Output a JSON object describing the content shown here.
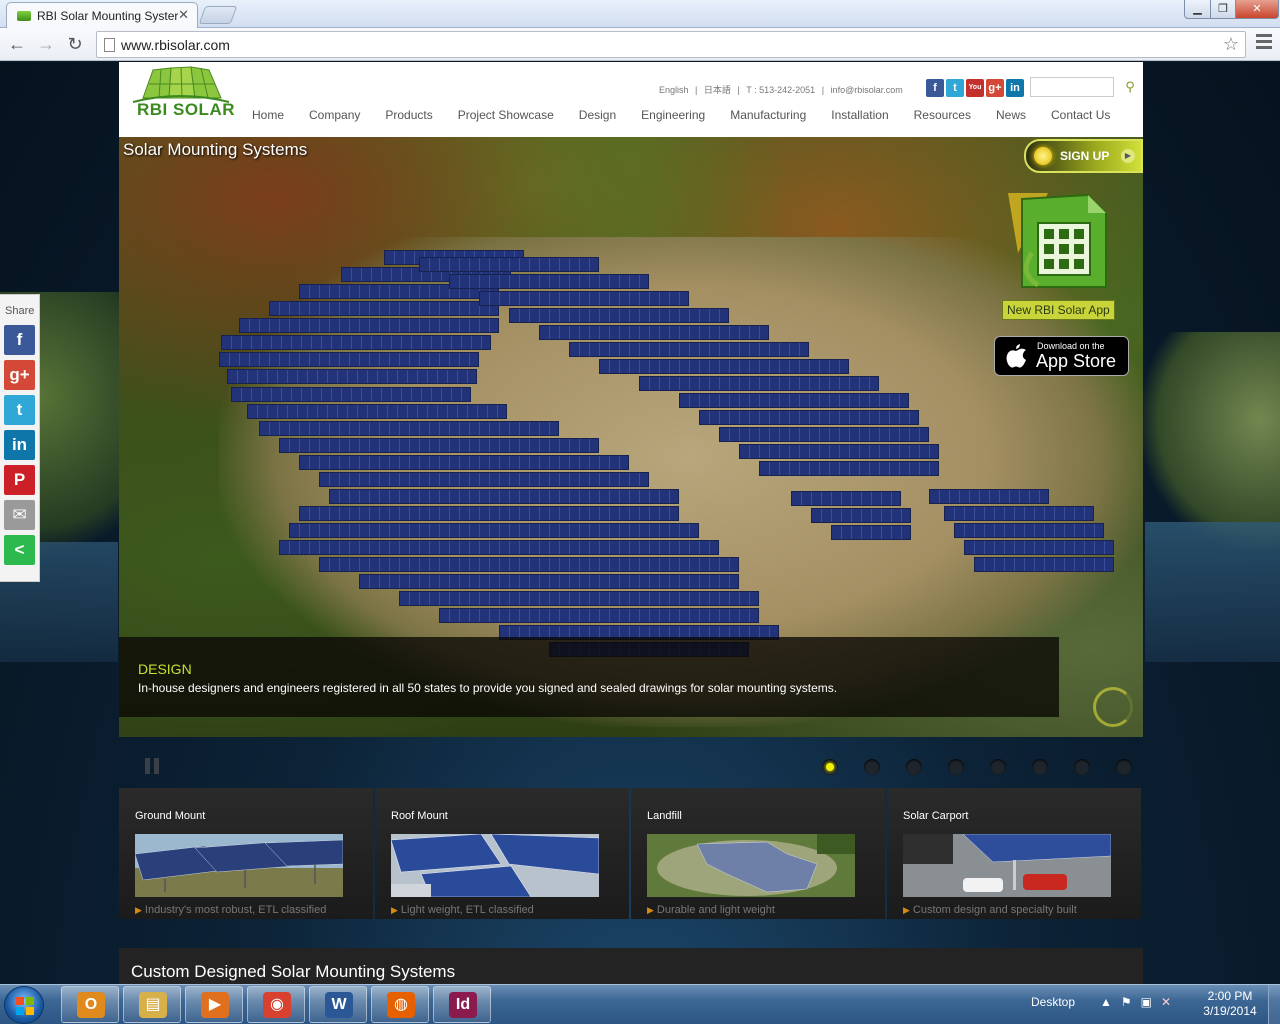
{
  "browser": {
    "tab_title": "RBI Solar Mounting Syster",
    "url": "www.rbisolar.com"
  },
  "header": {
    "logo_text": "RBI SOLAR",
    "top_links": [
      "English",
      "|",
      "日本語",
      "|",
      "T : 513-242-2051",
      "|",
      "info@rbisolar.com"
    ],
    "social": [
      {
        "name": "facebook-icon",
        "glyph": "f",
        "color": "#3b5998"
      },
      {
        "name": "twitter-icon",
        "glyph": "t",
        "color": "#2fa8d8"
      },
      {
        "name": "youtube-icon",
        "glyph": "You",
        "color": "#c4302b"
      },
      {
        "name": "google-plus-icon",
        "glyph": "g+",
        "color": "#d34836"
      },
      {
        "name": "linkedin-icon",
        "glyph": "in",
        "color": "#0e76a8"
      }
    ],
    "nav": [
      "Home",
      "Company",
      "Products",
      "Project Showcase",
      "Design",
      "Engineering",
      "Manufacturing",
      "Installation",
      "Resources",
      "News",
      "Contact Us"
    ]
  },
  "hero": {
    "title": "Solar Mounting Systems",
    "signup_label": "SIGN UP",
    "app_label": "New RBI Solar App",
    "appstore_small": "Download on the",
    "appstore_big": "App Store",
    "caption_title": "DESIGN",
    "caption_text": "In-house designers and engineers registered in all 50 states to provide you signed and sealed drawings for solar mounting systems.",
    "slide_count": 8,
    "active_slide": 1
  },
  "cards": [
    {
      "title": "Ground Mount",
      "desc": "Industry's most robust, ETL classified"
    },
    {
      "title": "Roof Mount",
      "desc": "Light weight, ETL classified"
    },
    {
      "title": "Landfill",
      "desc": "Durable and light weight"
    },
    {
      "title": "Solar Carport",
      "desc": "Custom design and specialty built"
    }
  ],
  "section": {
    "title": "Custom Designed Solar Mounting Systems"
  },
  "sharebar": {
    "label": "Share",
    "buttons": [
      {
        "name": "share-facebook-button",
        "glyph": "f",
        "color": "#3b5998"
      },
      {
        "name": "share-google-plus-button",
        "glyph": "g+",
        "color": "#d34836"
      },
      {
        "name": "share-twitter-button",
        "glyph": "t",
        "color": "#2fa8d8"
      },
      {
        "name": "share-linkedin-button",
        "glyph": "in",
        "color": "#0e76a8"
      },
      {
        "name": "share-pinterest-button",
        "glyph": "P",
        "color": "#cb2027"
      },
      {
        "name": "share-email-button",
        "glyph": "✉",
        "color": "#9a9a9a"
      },
      {
        "name": "share-more-button",
        "glyph": "<",
        "color": "#2db94d"
      }
    ]
  },
  "taskbar": {
    "tray_label": "Desktop",
    "time": "2:00 PM",
    "date": "3/19/2014",
    "apps": [
      {
        "name": "outlook-taskbar-icon",
        "glyph": "O",
        "color": "#e08a1e"
      },
      {
        "name": "explorer-taskbar-icon",
        "glyph": "▤",
        "color": "#d8b04a"
      },
      {
        "name": "media-player-taskbar-icon",
        "glyph": "▶",
        "color": "#e0701e"
      },
      {
        "name": "chrome-taskbar-icon",
        "glyph": "◉",
        "color": "#d8412f"
      },
      {
        "name": "word-taskbar-icon",
        "glyph": "W",
        "color": "#2b5797"
      },
      {
        "name": "firefox-taskbar-icon",
        "glyph": "◍",
        "color": "#e66000"
      },
      {
        "name": "indesign-taskbar-icon",
        "glyph": "Id",
        "color": "#8b1a4e"
      }
    ]
  }
}
